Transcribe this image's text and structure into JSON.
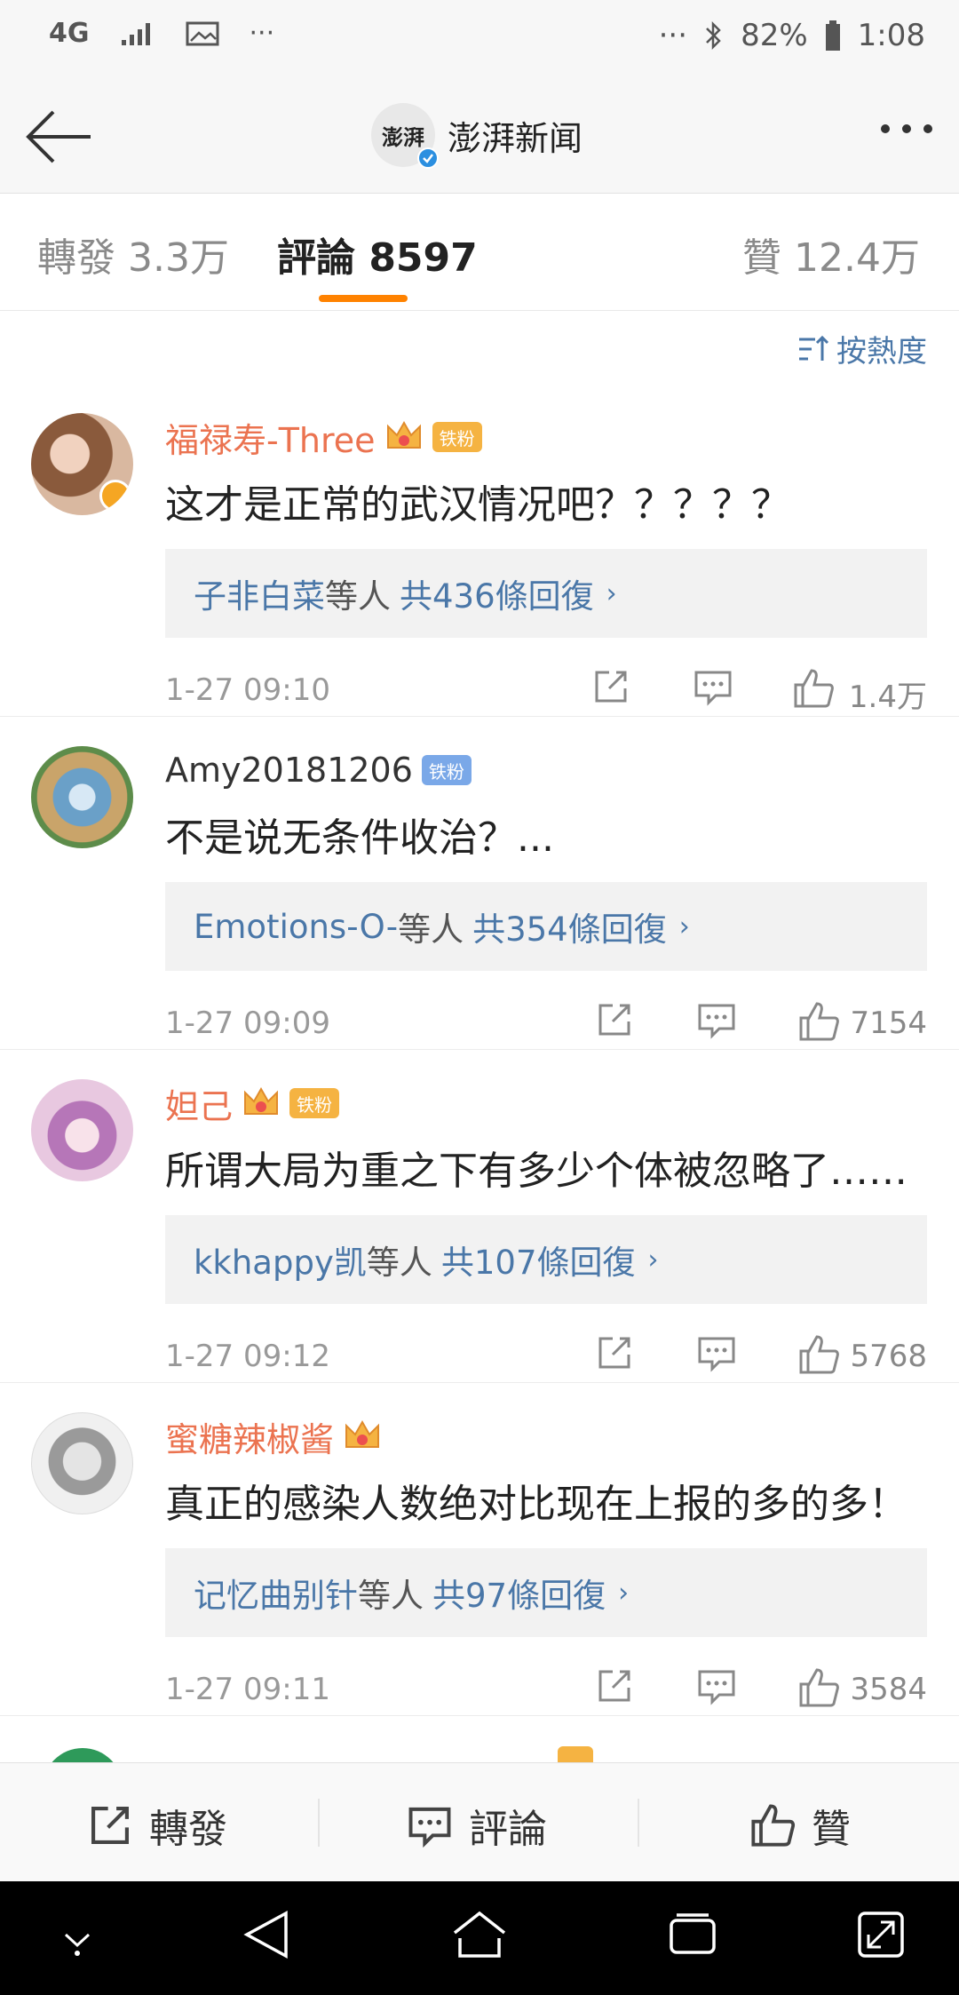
{
  "status_bar": {
    "network": "4G",
    "dots_left": "···",
    "dots_right": "···",
    "battery": "82%",
    "time": "1:08"
  },
  "header": {
    "avatar_text": "澎湃",
    "title": "澎湃新闻"
  },
  "tabs": [
    {
      "label": "轉發 3.3万"
    },
    {
      "label": "評論 8597"
    },
    {
      "label": "贊 12.4万"
    }
  ],
  "sort_label": "按熱度",
  "comments": [
    {
      "username": "福禄寿-Three",
      "fan_badge": "铁粉",
      "text": "这才是正常的武汉情况吧？？？？？",
      "reply_users": "子非白菜",
      "reply_mid": "等人",
      "reply_count": "共436條回復",
      "time": "1-27 09:10",
      "likes": "1.4万"
    },
    {
      "username": "Amy20181206",
      "fan_badge": "铁粉",
      "text": "不是说无条件收治？...",
      "reply_users": "Emotions-O-",
      "reply_mid": "等人",
      "reply_count": "共354條回復",
      "time": "1-27 09:09",
      "likes": "7154"
    },
    {
      "username": "妲己",
      "fan_badge": "铁粉",
      "text": "所谓大局为重之下有多少个体被忽略了……",
      "reply_users": "kkhappy凯",
      "reply_mid": "等人",
      "reply_count": "共107條回復",
      "time": "1-27 09:12",
      "likes": "5768"
    },
    {
      "username": "蜜糖辣椒酱",
      "fan_badge": "",
      "text": "真正的感染人数绝对比现在上报的多的多！",
      "reply_users": "记忆曲别针",
      "reply_mid": "等人",
      "reply_count": "共97條回復",
      "time": "1-27 09:11",
      "likes": "3584"
    }
  ],
  "bottom_bar": {
    "repost": "轉發",
    "comment": "評論",
    "like": "贊"
  },
  "colors": {
    "accent": "#ff8200",
    "link": "#4a77a8",
    "vip_name": "#eb7350"
  }
}
